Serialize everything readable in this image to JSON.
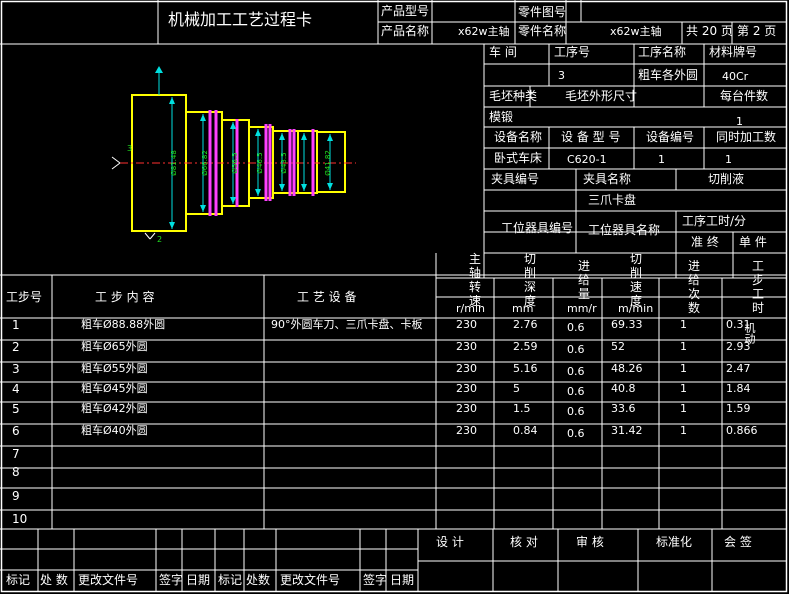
{
  "card_title": "机械加工工艺过程卡",
  "header": {
    "product_model_label": "产品型号",
    "part_drawing_label": "零件图号",
    "product_name_label": "产品名称",
    "product_name": "x62w主轴",
    "part_name_label": "零件名称",
    "part_name": "x62w主轴",
    "total_pages": "共 20 页",
    "page_no": "第 2 页"
  },
  "info": {
    "workshop_label": "车  间",
    "process_no_label": "工序号",
    "process_name_label": "工序名称",
    "material_label": "材料牌号",
    "process_no": "3",
    "process_name": "粗车各外圆",
    "material": "40Cr",
    "blank_type_label": "毛坯种类",
    "blank_size_label": "毛坯外形尺寸",
    "per_blank_label": "每台件数",
    "blank_type": "模锻",
    "per_blank": "1",
    "equip_name_label": "设备名称",
    "equip_model_label": "设 备 型 号",
    "equip_no_label": "设备编号",
    "concurrent_label": "同时加工数",
    "equip_name": "卧式车床",
    "equip_model": "C620-1",
    "equip_no": "1",
    "concurrent": "1",
    "fixture_no_label": "夹具编号",
    "fixture_name_label": "夹具名称",
    "coolant_label": "切削液",
    "fixture_name": "三爪卡盘",
    "station_no_label": "工位器具编号",
    "station_name_label": "工位器具名称",
    "time_label": "工序工时/分",
    "prep_label": "准 终",
    "unit_label": "单 件"
  },
  "sketch": {
    "dims": [
      "Ø81.48",
      "Ø66.82",
      "Ø56.5",
      "Ø46.5",
      "Ø43.5",
      "Ø41.82"
    ],
    "datum_labels": [
      "3",
      "2"
    ]
  },
  "table": {
    "col_step_no": "工步号",
    "col_content": "工 步 内 容",
    "col_equipment": "工 艺 设 备",
    "col_spindle": [
      "主",
      "轴",
      "转",
      "速"
    ],
    "col_spindle_unit": "r/min",
    "col_depth": [
      "切",
      "削",
      "深",
      "度"
    ],
    "col_depth_unit": "mm",
    "col_feed": [
      "进",
      "给",
      "量"
    ],
    "col_feed_unit": "mm/r",
    "col_speed": [
      "切",
      "削",
      "速",
      "度"
    ],
    "col_speed_unit": "m/min",
    "col_passes": [
      "进",
      "给",
      "次",
      "数"
    ],
    "col_hours": [
      "工",
      "步",
      "工",
      "时"
    ],
    "col_hours_sub": "机动",
    "rows": [
      {
        "no": "1",
        "content": "粗车Ø88.88外圆",
        "equipment": "90°外圆车刀、三爪卡盘、卡板",
        "rpm": "230",
        "depth": "2.76",
        "feed": "0.6",
        "speed": "69.33",
        "passes": "1",
        "time": "0.31"
      },
      {
        "no": "2",
        "content": "粗车Ø65外圆",
        "equipment": "",
        "rpm": "230",
        "depth": "2.59",
        "feed": "0.6",
        "speed": "52",
        "passes": "1",
        "time": "2.93"
      },
      {
        "no": "3",
        "content": "粗车Ø55外圆",
        "equipment": "",
        "rpm": "230",
        "depth": "5.16",
        "feed": "0.6",
        "speed": "48.26",
        "passes": "1",
        "time": "2.47"
      },
      {
        "no": "4",
        "content": "粗车Ø45外圆",
        "equipment": "",
        "rpm": "230",
        "depth": "5",
        "feed": "0.6",
        "speed": "40.8",
        "passes": "1",
        "time": "1.84"
      },
      {
        "no": "5",
        "content": "粗车Ø42外圆",
        "equipment": "",
        "rpm": "230",
        "depth": "1.5",
        "feed": "0.6",
        "speed": "33.6",
        "passes": "1",
        "time": "1.59"
      },
      {
        "no": "6",
        "content": "粗车Ø40外圆",
        "equipment": "",
        "rpm": "230",
        "depth": "0.84",
        "feed": "0.6",
        "speed": "31.42",
        "passes": "1",
        "time": "0.866"
      },
      {
        "no": "7",
        "content": "",
        "equipment": "",
        "rpm": "",
        "depth": "",
        "feed": "",
        "speed": "",
        "passes": "",
        "time": ""
      },
      {
        "no": "8",
        "content": "",
        "equipment": "",
        "rpm": "",
        "depth": "",
        "feed": "",
        "speed": "",
        "passes": "",
        "time": ""
      },
      {
        "no": "9",
        "content": "",
        "equipment": "",
        "rpm": "",
        "depth": "",
        "feed": "",
        "speed": "",
        "passes": "",
        "time": ""
      },
      {
        "no": "10",
        "content": "",
        "equipment": "",
        "rpm": "",
        "depth": "",
        "feed": "",
        "speed": "",
        "passes": "",
        "time": ""
      }
    ]
  },
  "footer": {
    "design": "设 计",
    "check": "核 对",
    "review": "审 核",
    "standard": "标准化",
    "countersign": "会 签",
    "mark": "标记",
    "count": "处 数",
    "change_doc": "更改文件号",
    "sign": "签字",
    "date": "日期",
    "mark2": "标记",
    "count2": "处数",
    "change_doc2": "更改文件号",
    "sign2": "签字",
    "date2": "日期"
  }
}
